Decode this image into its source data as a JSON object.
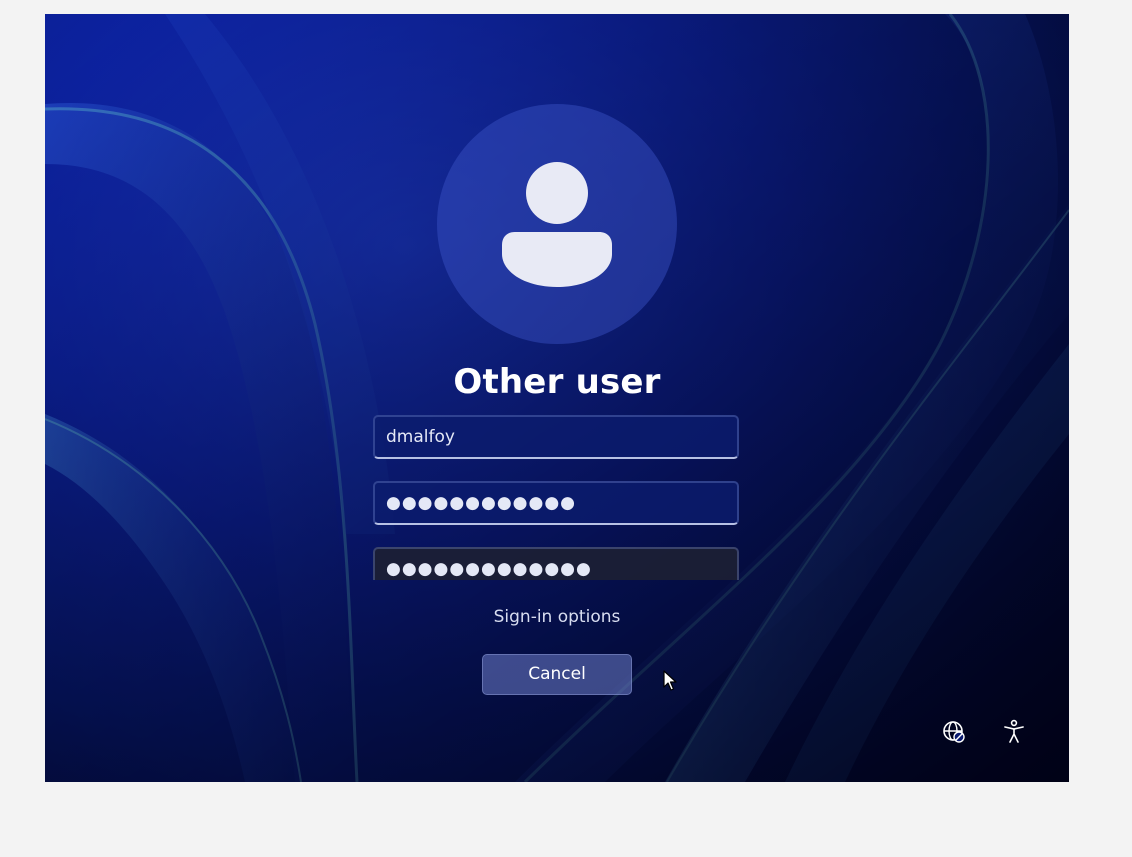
{
  "login": {
    "user_title": "Other user",
    "username_value": "dmalfoy",
    "password_value": "●●●●●●●●●●●●",
    "confirm_password_value": "●●●●●●●●●●●●●",
    "signin_options_label": "Sign-in options",
    "cancel_label": "Cancel"
  },
  "icons": {
    "avatar": "user-avatar-icon",
    "network": "network-globe-icon",
    "accessibility": "accessibility-icon",
    "cursor": "mouse-cursor-icon"
  },
  "colors": {
    "wallpaper_base": "#0d23a6",
    "ribbon": "#3a7fd6",
    "text": "#ffffff"
  }
}
